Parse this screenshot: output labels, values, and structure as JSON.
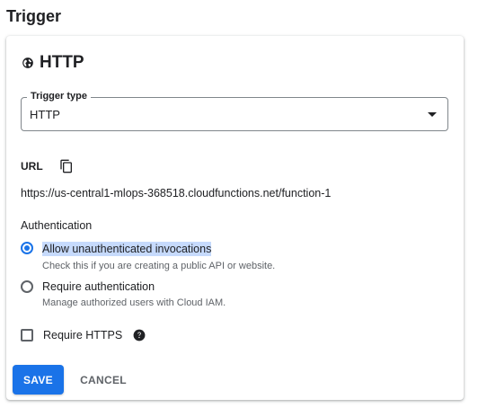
{
  "section": {
    "title": "Trigger"
  },
  "card": {
    "title": "HTTP",
    "icon": "globe-icon"
  },
  "trigger_type": {
    "label": "Trigger type",
    "value": "HTTP"
  },
  "url": {
    "label": "URL",
    "copy_icon": "copy-icon",
    "value": "https://us-central1-mlops-368518.cloudfunctions.net/function-1"
  },
  "authentication": {
    "label": "Authentication",
    "options": [
      {
        "label": "Allow unauthenticated invocations",
        "hint": "Check this if you are creating a public API or website.",
        "selected": true
      },
      {
        "label": "Require authentication",
        "hint": "Manage authorized users with Cloud IAM.",
        "selected": false
      }
    ]
  },
  "https": {
    "label": "Require HTTPS",
    "checked": false,
    "help_icon": "help-icon"
  },
  "actions": {
    "save": "SAVE",
    "cancel": "CANCEL"
  },
  "colors": {
    "accent": "#1a73e8",
    "selection": "#c6dafc"
  }
}
